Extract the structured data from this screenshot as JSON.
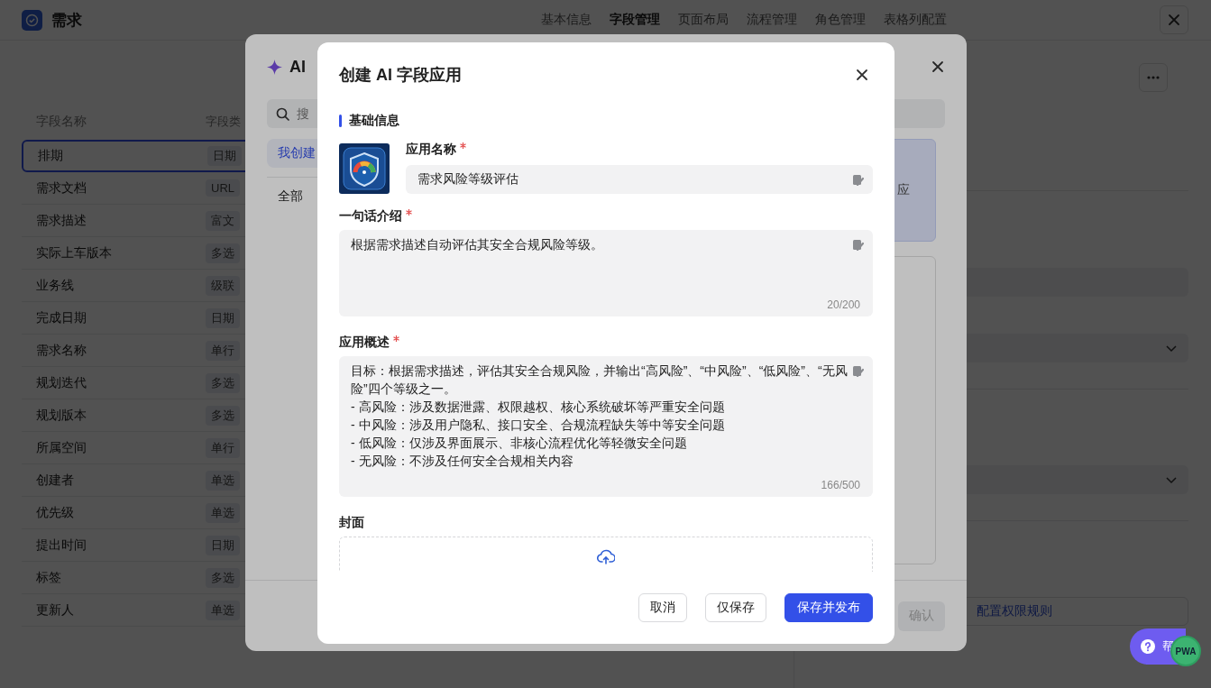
{
  "app": {
    "title": "需求"
  },
  "nav_tabs": [
    {
      "label": "基本信息",
      "selected": false
    },
    {
      "label": "字段管理",
      "selected": true
    },
    {
      "label": "页面布局",
      "selected": false
    },
    {
      "label": "流程管理",
      "selected": false
    },
    {
      "label": "角色管理",
      "selected": false
    },
    {
      "label": "表格列配置",
      "selected": false
    }
  ],
  "fields_table": {
    "columns": [
      "字段名称",
      "字段类"
    ],
    "rows": [
      {
        "name": "排期",
        "type": "日期",
        "selected": true
      },
      {
        "name": "需求文档",
        "type": "URL",
        "selected": false
      },
      {
        "name": "需求描述",
        "type": "富文",
        "selected": false
      },
      {
        "name": "实际上车版本",
        "type": "多选",
        "selected": false
      },
      {
        "name": "业务线",
        "type": "级联",
        "selected": false
      },
      {
        "name": "完成日期",
        "type": "日期",
        "selected": false
      },
      {
        "name": "需求名称",
        "type": "单行",
        "selected": false
      },
      {
        "name": "规划迭代",
        "type": "多选",
        "selected": false
      },
      {
        "name": "规划版本",
        "type": "多选",
        "selected": false
      },
      {
        "name": "所属空间",
        "type": "单行",
        "selected": false
      },
      {
        "name": "创建者",
        "type": "单选",
        "selected": false
      },
      {
        "name": "优先级",
        "type": "单选",
        "selected": false
      },
      {
        "name": "提出时间",
        "type": "日期",
        "selected": false
      },
      {
        "name": "标签",
        "type": "多选",
        "selected": false
      },
      {
        "name": "更新人",
        "type": "单选",
        "selected": false
      }
    ]
  },
  "settings_panel": {
    "link_button": "配置权限规则"
  },
  "ai_library_dialog": {
    "title": "AI",
    "search": {
      "placeholder": "搜"
    },
    "tabs": [
      {
        "label": "我创建",
        "selected": true
      }
    ],
    "categories": [
      "全部"
    ],
    "card_text": "应",
    "confirm_button": {
      "label": "确认",
      "disabled": true
    }
  },
  "create_dialog": {
    "title": "创建 AI 字段应用",
    "section_title": "基础信息",
    "name_field": {
      "label": "应用名称",
      "required": true,
      "value": "需求风险等级评估"
    },
    "intro_field": {
      "label": "一句话介绍",
      "required": true,
      "value": "根据需求描述自动评估其安全合规风险等级。",
      "counter": "20/200"
    },
    "overview_field": {
      "label": "应用概述",
      "required": true,
      "value": "目标：根据需求描述，评估其安全合规风险，并输出“高风险”、“中风险”、“低风险”、“无风险”四个等级之一。\n- 高风险：涉及数据泄露、权限越权、核心系统破坏等严重安全问题\n- 中风险：涉及用户隐私、接口安全、合规流程缺失等中等安全问题\n- 低风险：仅涉及界面展示、非核心流程优化等轻微安全问题\n- 无风险：不涉及任何安全合规相关内容",
      "counter": "166/500"
    },
    "cover": {
      "label": "封面"
    },
    "buttons": [
      {
        "label": "取消",
        "kind": "default"
      },
      {
        "label": "仅保存",
        "kind": "default"
      },
      {
        "label": "保存并发布",
        "kind": "primary"
      }
    ]
  },
  "help_button": {
    "label": "帮"
  },
  "pwa_badge": {
    "label": "PWA"
  }
}
